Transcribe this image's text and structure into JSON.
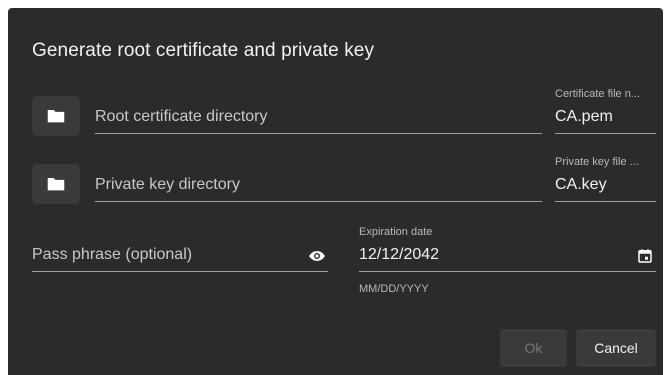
{
  "dialog": {
    "title": "Generate root certificate and private key"
  },
  "root_cert": {
    "directory_placeholder": "Root certificate directory",
    "file_label": "Certificate file n...",
    "file_value": "CA.pem"
  },
  "private_key": {
    "directory_placeholder": "Private key directory",
    "file_label": "Private key file ...",
    "file_value": "CA.key"
  },
  "pass_phrase": {
    "placeholder": "Pass phrase (optional)"
  },
  "expiration": {
    "label": "Expiration date",
    "value": "12/12/2042",
    "hint": "MM/DD/YYYY"
  },
  "buttons": {
    "ok_label": "Ok",
    "ok_disabled": true,
    "cancel_label": "Cancel"
  },
  "icons": {
    "folder": "folder-icon",
    "visibility": "eye-icon",
    "calendar": "calendar-icon"
  },
  "colors": {
    "dialog_bg": "#2b2b2b",
    "button_bg": "#3a3a3a",
    "text": "#f2f2f2",
    "muted": "#b8b8b8"
  }
}
